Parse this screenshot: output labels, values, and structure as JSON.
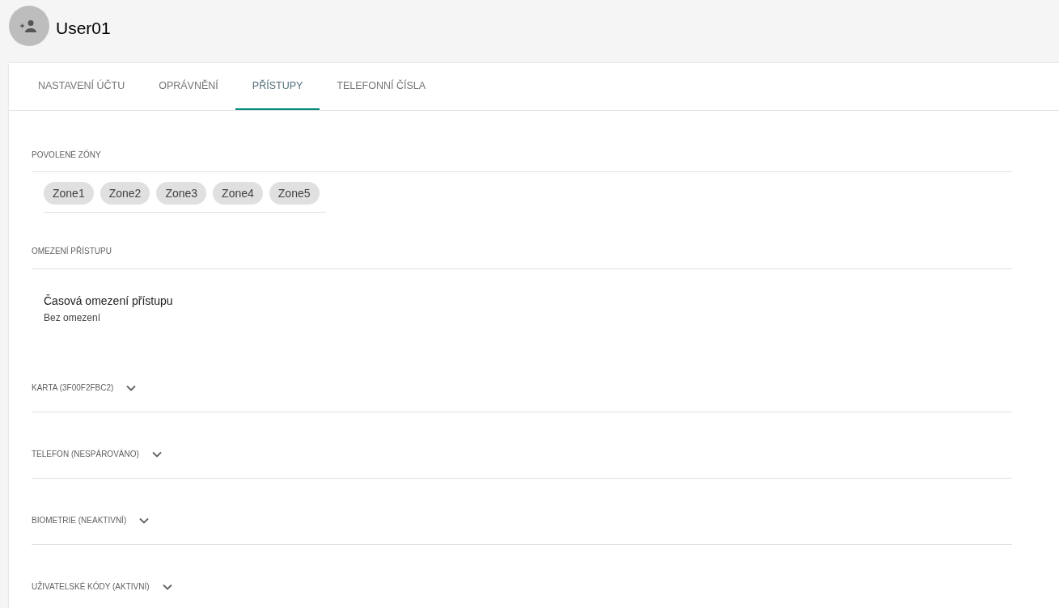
{
  "user": {
    "name": "User01"
  },
  "tabs": [
    {
      "label": "NASTAVENÍ ÚČTU",
      "selected": false
    },
    {
      "label": "OPRÁVNĚNÍ",
      "selected": false
    },
    {
      "label": "PŘÍSTUPY",
      "selected": true
    },
    {
      "label": "TELEFONNÍ ČÍSLA",
      "selected": false
    }
  ],
  "allowed_zones": {
    "heading": "POVOLENÉ ZÓNY",
    "chips": [
      "Zone1",
      "Zone2",
      "Zone3",
      "Zone4",
      "Zone5"
    ]
  },
  "access_restriction": {
    "heading": "OMEZENÍ PŘÍSTUPU",
    "title": "Časová omezení přístupu",
    "value": "Bez omezení"
  },
  "sections": [
    {
      "label": "KARTA (3F00F2FBC2)",
      "expanded": false
    },
    {
      "label": "TELEFON (NESPÁROVÁNO)",
      "expanded": false
    },
    {
      "label": "BIOMETRIE (NEAKTIVNÍ)",
      "expanded": false
    },
    {
      "label": "UŽIVATELSKÉ KÓDY (AKTIVNÍ)",
      "expanded": false
    }
  ]
}
